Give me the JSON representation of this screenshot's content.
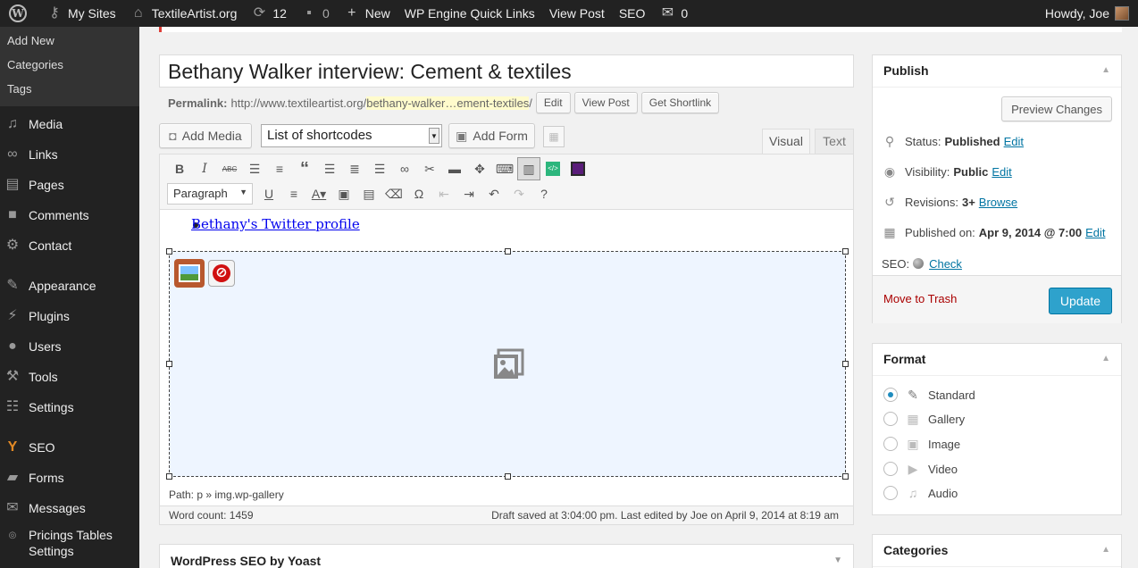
{
  "adminbar": {
    "my_sites": "My Sites",
    "site_name": "TextileArtist.org",
    "updates_count": "12",
    "comments_count": "0",
    "new_label": "New",
    "wpengine": "WP Engine Quick Links",
    "view_post": "View Post",
    "seo": "SEO",
    "messages_count": "0",
    "howdy": "Howdy, Joe"
  },
  "sidebar": {
    "submenu": [
      "Add New",
      "Categories",
      "Tags"
    ],
    "items": [
      {
        "label": "Media",
        "icon": "media-icon"
      },
      {
        "label": "Links",
        "icon": "links-icon"
      },
      {
        "label": "Pages",
        "icon": "pages-icon"
      },
      {
        "label": "Comments",
        "icon": "comments-icon"
      },
      {
        "label": "Contact",
        "icon": "gear-icon"
      },
      {
        "label": "Appearance",
        "icon": "brush-icon"
      },
      {
        "label": "Plugins",
        "icon": "plug-icon"
      },
      {
        "label": "Users",
        "icon": "user-icon"
      },
      {
        "label": "Tools",
        "icon": "wrench-icon"
      },
      {
        "label": "Settings",
        "icon": "settings-icon"
      },
      {
        "label": "SEO",
        "icon": "yoast-icon"
      },
      {
        "label": "Forms",
        "icon": "folder-icon"
      },
      {
        "label": "Messages",
        "icon": "envelope-icon"
      },
      {
        "label": "Pricings Tables",
        "label2": "Settings",
        "icon": "pricing-icon"
      }
    ]
  },
  "editor": {
    "title": "Bethany Walker interview: Cement & textiles",
    "permalink_label": "Permalink:",
    "permalink_base": "http://www.textileartist.org/",
    "permalink_slug": "bethany-walker…ement-textiles",
    "permalink_trailing": "/",
    "edit_btn": "Edit",
    "view_post_btn": "View Post",
    "shortlink_btn": "Get Shortlink",
    "add_media": "Add Media",
    "shortcodes_select": "List of shortcodes",
    "add_form": "Add Form",
    "tab_visual": "Visual",
    "tab_text": "Text",
    "format_select": "Paragraph",
    "content_link": "Bethany's Twitter profile",
    "path": "Path: p » img.wp-gallery",
    "word_count": "Word count: 1459",
    "draft_status": "Draft saved at 3:04:00 pm. Last edited by Joe on April 9, 2014 at 8:19 am"
  },
  "seo_box": {
    "title": "WordPress SEO by Yoast"
  },
  "publish": {
    "title": "Publish",
    "preview_btn": "Preview Changes",
    "status_label": "Status:",
    "status_value": "Published",
    "visibility_label": "Visibility:",
    "visibility_value": "Public",
    "revisions_label": "Revisions:",
    "revisions_value": "3+",
    "browse": "Browse",
    "published_label": "Published on:",
    "published_value": "Apr 9, 2014 @ 7:00",
    "edit": "Edit",
    "seo_label": "SEO:",
    "seo_check": "Check",
    "trash": "Move to Trash",
    "update": "Update"
  },
  "format": {
    "title": "Format",
    "options": [
      "Standard",
      "Gallery",
      "Image",
      "Video",
      "Audio"
    ],
    "selected": "Standard"
  },
  "categories": {
    "title": "Categories"
  },
  "colors": {
    "accent": "#2ea2cc",
    "admin_bar": "#222222",
    "link": "#0074a2",
    "trash": "#aa0000"
  }
}
